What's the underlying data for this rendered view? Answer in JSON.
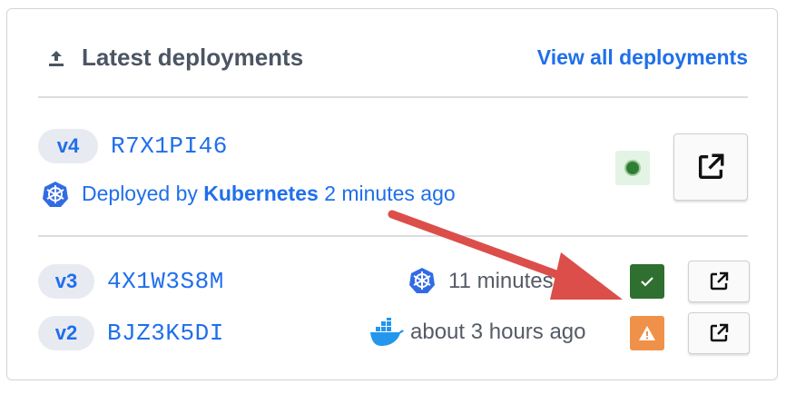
{
  "panel": {
    "title": "Latest deployments",
    "view_all_label": "View all deployments"
  },
  "deployments": [
    {
      "version": "v4",
      "sha": "R7X1PI46",
      "deployed_prefix": "Deployed by",
      "deployer": "Kubernetes",
      "time": "2 minutes ago",
      "platform_icon": "kubernetes-icon",
      "status": "running",
      "status_color": "#2e7d32"
    },
    {
      "version": "v3",
      "sha": "4X1W3S8M",
      "time": "11 minutes ago",
      "platform_icon": "kubernetes-icon",
      "status": "success",
      "status_color": "#2f6f2f"
    },
    {
      "version": "v2",
      "sha": "BJZ3K5DI",
      "time": "about 3 hours ago",
      "platform_icon": "docker-icon",
      "status": "warning",
      "status_color": "#f0914a"
    }
  ],
  "colors": {
    "link": "#1f6feb",
    "annotation_arrow": "#dc4e4a"
  }
}
